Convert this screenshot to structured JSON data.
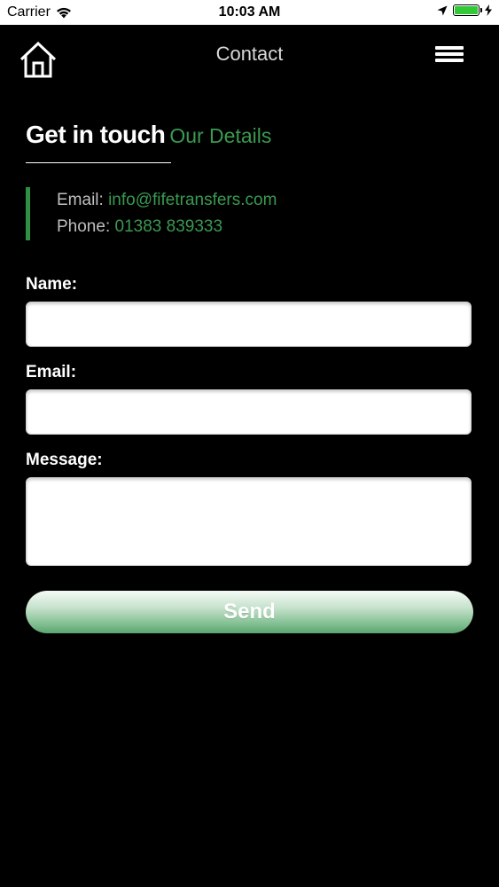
{
  "status_bar": {
    "carrier": "Carrier",
    "time": "10:03 AM",
    "battery_level": 1.0,
    "battery_color": "#32c838"
  },
  "nav": {
    "title": "Contact",
    "home_icon": "home-icon",
    "menu_icon": "hamburger-menu-icon"
  },
  "section": {
    "title": "Get in touch",
    "subtitle": "Our Details",
    "accent_color": "#3a9a50"
  },
  "details": {
    "email_label": "Email:",
    "email_value": "info@fifetransfers.com",
    "phone_label": "Phone:",
    "phone_value": "01383 839333"
  },
  "form": {
    "name_label": "Name:",
    "name_value": "",
    "email_label": "Email:",
    "email_value": "",
    "message_label": "Message:",
    "message_value": "",
    "send_label": "Send"
  }
}
